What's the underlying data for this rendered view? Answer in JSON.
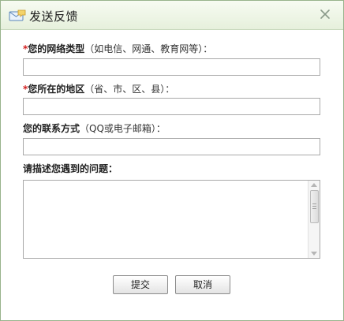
{
  "dialog": {
    "title": "发送反馈",
    "icons": {
      "title": "feedback-icon",
      "close": "close-icon"
    }
  },
  "form": {
    "network": {
      "required_mark": "*",
      "label": "您的网络类型",
      "hint": "（如电信、网通、教育网等）：",
      "value": ""
    },
    "region": {
      "required_mark": "*",
      "label": "您所在的地区",
      "hint": "（省、市、区、县）：",
      "value": ""
    },
    "contact": {
      "label": "您的联系方式",
      "hint": "（QQ或电子邮箱）：",
      "value": ""
    },
    "problem": {
      "label": "请描述您遇到的问题：",
      "value": ""
    }
  },
  "buttons": {
    "submit": "提交",
    "cancel": "取消"
  },
  "colors": {
    "titlebar_bg": "#e6f0dc",
    "border": "#98b38c",
    "required": "#d21e1e"
  }
}
